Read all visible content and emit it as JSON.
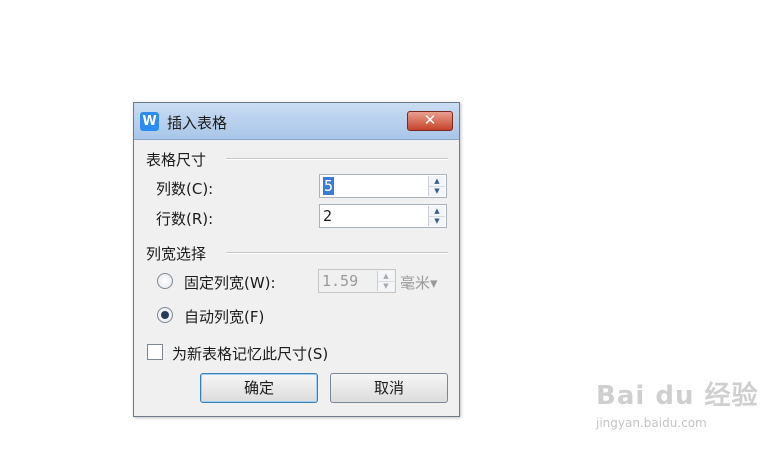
{
  "dialog": {
    "title": "插入表格",
    "app_icon": "W",
    "close_label": "✕"
  },
  "table_size": {
    "section_title": "表格尺寸",
    "columns_label": "列数(C):",
    "columns_value": "5",
    "rows_label": "行数(R):",
    "rows_value": "2"
  },
  "column_width": {
    "section_title": "列宽选择",
    "fixed_label": "固定列宽(W):",
    "fixed_value": "1.59",
    "unit": "毫米▾",
    "auto_label": "自动列宽(F)",
    "selected": "auto"
  },
  "remember_label": "为新表格记忆此尺寸(S)",
  "remember_checked": false,
  "buttons": {
    "ok": "确定",
    "cancel": "取消"
  },
  "watermark": {
    "brand": "Bai du 经验",
    "url": "jingyan.baidu.com"
  },
  "colors": {
    "selection": "#3a7bd5",
    "close_button": "#c6432c",
    "titlebar": "#b9d1ee"
  }
}
